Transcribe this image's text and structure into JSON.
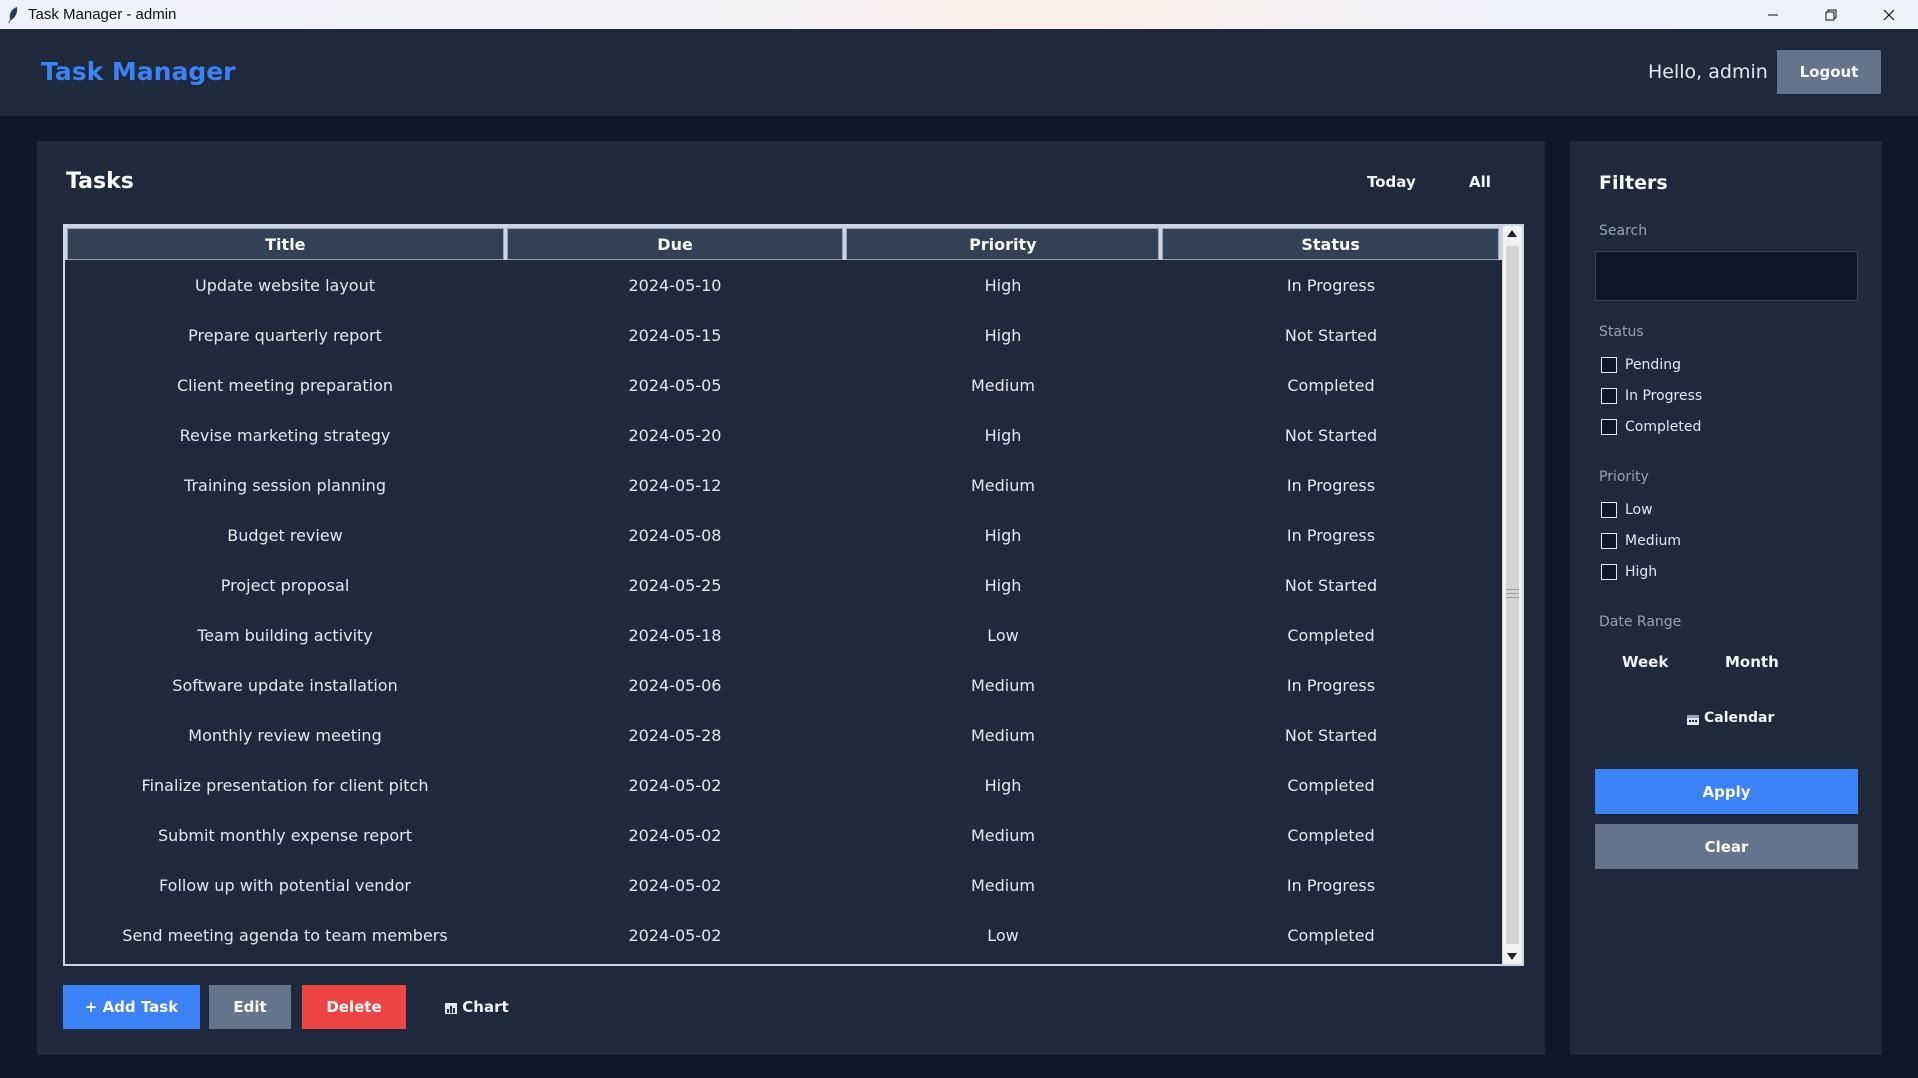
{
  "window": {
    "title": "Task Manager - admin"
  },
  "header": {
    "app_title": "Task Manager",
    "greeting": "Hello, admin",
    "logout_label": "Logout"
  },
  "tasks": {
    "title": "Tasks",
    "view_today": "Today",
    "view_all": "All",
    "columns": [
      "Title",
      "Due",
      "Priority",
      "Status"
    ],
    "rows": [
      [
        "Update website layout",
        "2024-05-10",
        "High",
        "In Progress"
      ],
      [
        "Prepare quarterly report",
        "2024-05-15",
        "High",
        "Not Started"
      ],
      [
        "Client meeting preparation",
        "2024-05-05",
        "Medium",
        "Completed"
      ],
      [
        "Revise marketing strategy",
        "2024-05-20",
        "High",
        "Not Started"
      ],
      [
        "Training session planning",
        "2024-05-12",
        "Medium",
        "In Progress"
      ],
      [
        "Budget review",
        "2024-05-08",
        "High",
        "In Progress"
      ],
      [
        "Project proposal",
        "2024-05-25",
        "High",
        "Not Started"
      ],
      [
        "Team building activity",
        "2024-05-18",
        "Low",
        "Completed"
      ],
      [
        "Software update installation",
        "2024-05-06",
        "Medium",
        "In Progress"
      ],
      [
        "Monthly review meeting",
        "2024-05-28",
        "Medium",
        "Not Started"
      ],
      [
        "Finalize presentation for client pitch",
        "2024-05-02",
        "High",
        "Completed"
      ],
      [
        "Submit monthly expense report",
        "2024-05-02",
        "Medium",
        "Completed"
      ],
      [
        "Follow up with potential vendor",
        "2024-05-02",
        "Medium",
        "In Progress"
      ],
      [
        "Send meeting agenda to team members",
        "2024-05-02",
        "Low",
        "Completed"
      ]
    ],
    "actions": {
      "add_label": "+ Add Task",
      "edit_label": "Edit",
      "delete_label": "Delete",
      "chart_label": "Chart"
    }
  },
  "filters": {
    "title": "Filters",
    "search_label": "Search",
    "search_value": "",
    "status_label": "Status",
    "status_options": [
      "Pending",
      "In Progress",
      "Completed"
    ],
    "priority_label": "Priority",
    "priority_options": [
      "Low",
      "Medium",
      "High"
    ],
    "date_range_label": "Date Range",
    "week_label": "Week",
    "month_label": "Month",
    "calendar_label": "Calendar",
    "apply_label": "Apply",
    "clear_label": "Clear"
  },
  "colors": {
    "accent": "#3b82f6",
    "danger": "#ef4444",
    "secondary": "#64748b",
    "panel": "#1e293b",
    "background": "#0f172a"
  }
}
